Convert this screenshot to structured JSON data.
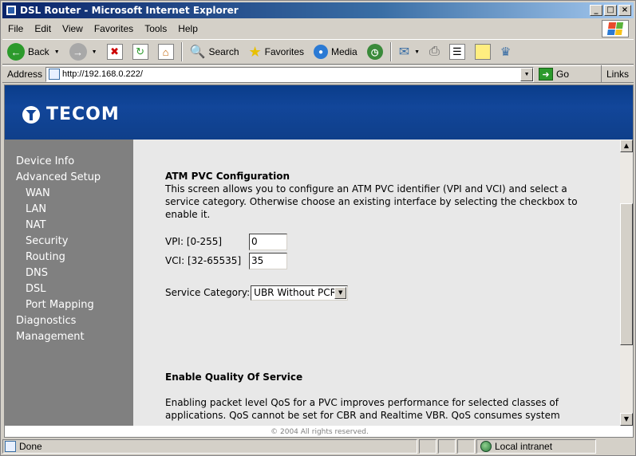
{
  "window": {
    "title": "DSL Router - Microsoft Internet Explorer",
    "controls": {
      "minimize": "_",
      "maximize": "□",
      "close": "×"
    }
  },
  "menu": [
    "File",
    "Edit",
    "View",
    "Favorites",
    "Tools",
    "Help"
  ],
  "toolbar": {
    "back": "Back",
    "search": "Search",
    "favorites": "Favorites",
    "media": "Media"
  },
  "address": {
    "label": "Address",
    "url": "http://192.168.0.222/",
    "go": "Go",
    "links": "Links"
  },
  "banner": {
    "logo_text": "TECOM"
  },
  "sidebar": {
    "items": [
      {
        "label": "Device Info",
        "level": 0
      },
      {
        "label": "Advanced Setup",
        "level": 0
      },
      {
        "label": "WAN",
        "level": 1
      },
      {
        "label": "LAN",
        "level": 1
      },
      {
        "label": "NAT",
        "level": 1
      },
      {
        "label": "Security",
        "level": 1
      },
      {
        "label": "Routing",
        "level": 1
      },
      {
        "label": "DNS",
        "level": 1
      },
      {
        "label": "DSL",
        "level": 1
      },
      {
        "label": "Port Mapping",
        "level": 1
      },
      {
        "label": "Diagnostics",
        "level": 0
      },
      {
        "label": "Management",
        "level": 0
      }
    ]
  },
  "content": {
    "section_title": "ATM PVC Configuration",
    "description": "This screen allows you to configure an ATM PVC identifier (VPI and VCI) and select a service category. Otherwise choose an existing interface by selecting the checkbox to enable it.",
    "vpi_label": "VPI: [0-255]",
    "vpi_value": "0",
    "vci_label": "VCI: [32-65535]",
    "vci_value": "35",
    "service_label": "Service Category:",
    "service_value": "UBR Without PCR",
    "qos_title": "Enable Quality Of Service",
    "qos_text": "Enabling packet level QoS for a PVC improves performance for selected classes of applications. QoS cannot be set for CBR and Realtime VBR. QoS consumes system"
  },
  "footer": {
    "copyright": "© 2004 All rights reserved."
  },
  "status": {
    "text": "Done",
    "zone": "Local intranet"
  }
}
